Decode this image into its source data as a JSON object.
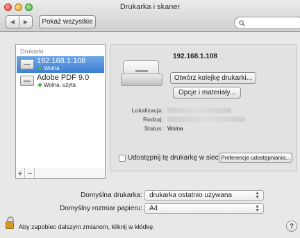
{
  "window": {
    "title": "Drukarka i skaner"
  },
  "toolbar": {
    "back_glyph": "◀",
    "forward_glyph": "▶",
    "show_all_label": "Pokaż wszystkie",
    "search_placeholder": ""
  },
  "printers": {
    "header": "Drukarki",
    "items": [
      {
        "name": "192.168.1.108",
        "status": "Wolna",
        "selected": true
      },
      {
        "name": "Adobe PDF 9.0",
        "status": "Wolna, użyta",
        "selected": false
      }
    ],
    "add_label": "+",
    "remove_label": "−"
  },
  "detail": {
    "printer_title": "192.168.1.108",
    "open_queue_label": "Otwórz kolejkę drukarki...",
    "options_label": "Opcje i materiały...",
    "location_label": "Lokalizacja:",
    "kind_label": "Rodzaj:",
    "status_label": "Status:",
    "status_value": "Wolna",
    "share_label": "Udostępnij tę drukarkę w sieci",
    "sharing_prefs_label": "Preferencje udostępniania..."
  },
  "defaults": {
    "default_printer_label": "Domyślna drukarka:",
    "default_printer_value": "drukarka ostatnio używana",
    "paper_size_label": "Domyślny rozmiar papieru:",
    "paper_size_value": "A4"
  },
  "footer": {
    "lock_text": "Aby zapobiec dalszym zmianom, kliknij w kłódkę.",
    "help_glyph": "?"
  },
  "colors": {
    "selection": "#3d7fd6",
    "status_dot": "#46b13d"
  }
}
